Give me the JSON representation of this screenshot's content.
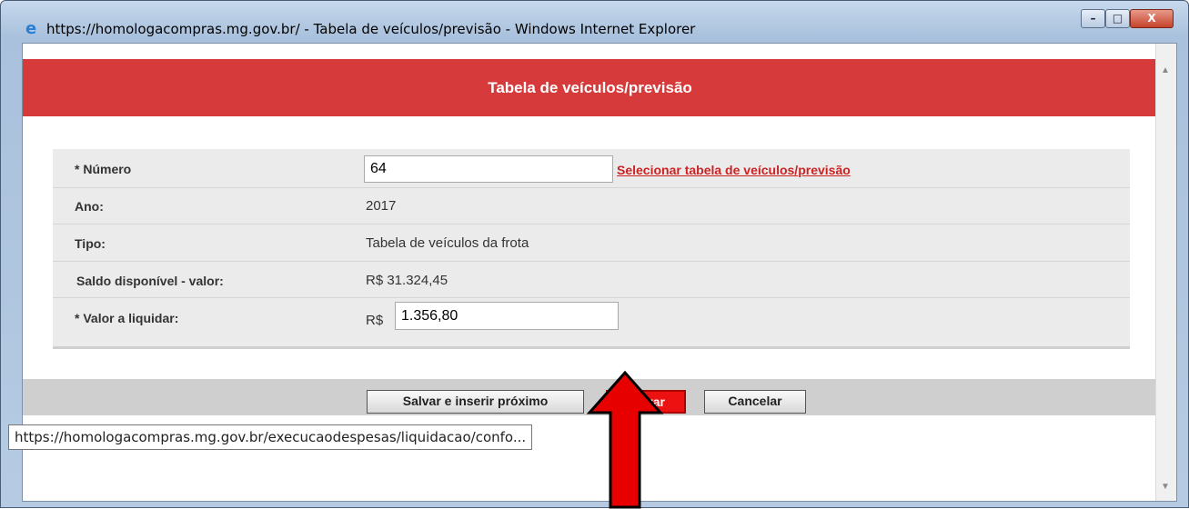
{
  "window": {
    "title": "https://homologacompras.mg.gov.br/ - Tabela de veículos/previsão - Windows Internet Explorer",
    "controls": {
      "minimize": "–",
      "maximize": "□",
      "close": "X"
    }
  },
  "header": {
    "title": "Tabela de veículos/previsão"
  },
  "form": {
    "numero": {
      "label": "* Número",
      "value": "64"
    },
    "select_link": "Selecionar tabela de veículos/previsão",
    "ano": {
      "label": "Ano:",
      "value": "2017"
    },
    "tipo": {
      "label": "Tipo:",
      "value": "Tabela de veículos da frota"
    },
    "saldo": {
      "label": "Saldo disponível - valor:",
      "value": "R$ 31.324,45"
    },
    "valor": {
      "label": "* Valor a liquidar:",
      "prefix": "R$",
      "value": "1.356,80"
    }
  },
  "buttons": {
    "save_next": "Salvar e inserir próximo",
    "save": "Salvar",
    "cancel": "Cancelar"
  },
  "status_tooltip": "https://homologacompras.mg.gov.br/execucaodespesas/liquidacao/confo...",
  "colors": {
    "header": "#d63a3a",
    "save_button": "#ee1111",
    "arrow": "#e60000"
  }
}
